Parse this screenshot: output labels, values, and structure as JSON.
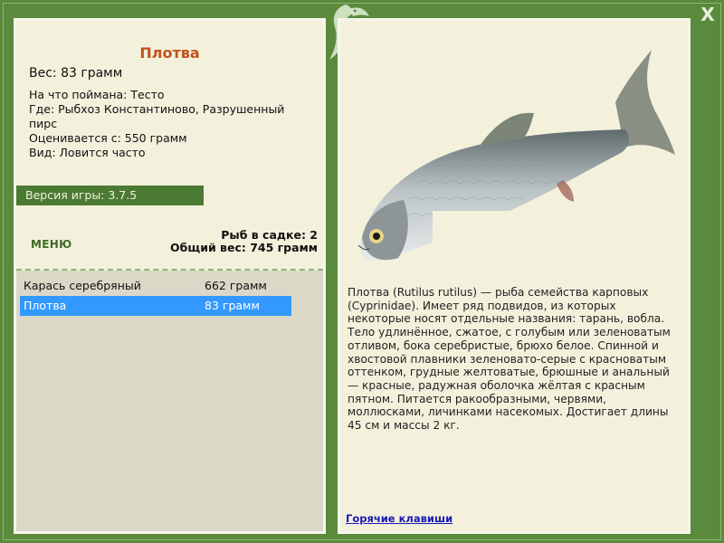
{
  "window": {
    "close_label": "X"
  },
  "fish": {
    "name": "Плотва",
    "weight": "Вес: 83 грамм",
    "details": [
      "На что поймана: Тесто",
      "Где: Рыбхоз Константиново, Разрушенный пирс",
      "Оценивается с: 550 грамм",
      "Вид: Ловится часто"
    ],
    "description": "Плотва (Rutilus rutilus) — рыба семейства карповых (Cyprinidae). Имеет ряд подвидов, из которых некоторые носят отдельные названия: тарань, вобла. Тело удлинённое, сжатое, с голубым или зеленоватым отливом, бока серебристые, брюхо белое. Спинной и хвостовой плавники зеленовато-серые с красноватым оттенком, грудные желтоватые, брюшные и анальный — красные, радужная оболочка жёлтая с красным пятном. Питается ракообразными, червями, моллюсками, личинками насекомых. Достигает длины 45 см и массы 2 кг.",
    "image_icon": "roach-fish-image"
  },
  "version": "Версия игры: 3.7.5",
  "menu_label": "МЕНЮ",
  "stats": {
    "count": "Рыб в садке: 2",
    "total": "Общий вес: 745 грамм"
  },
  "catch_list": [
    {
      "name": "Карась серебряный",
      "weight": "662 грамм"
    },
    {
      "name": "Плотва",
      "weight": "83 грамм"
    }
  ],
  "hotkeys_label": "Горячие клавиши",
  "colors": {
    "frame": "#5a8a3c",
    "panel": "#f3f1dc",
    "title": "#c0511b",
    "selected": "#3399ff",
    "link": "#1a1ab4"
  }
}
